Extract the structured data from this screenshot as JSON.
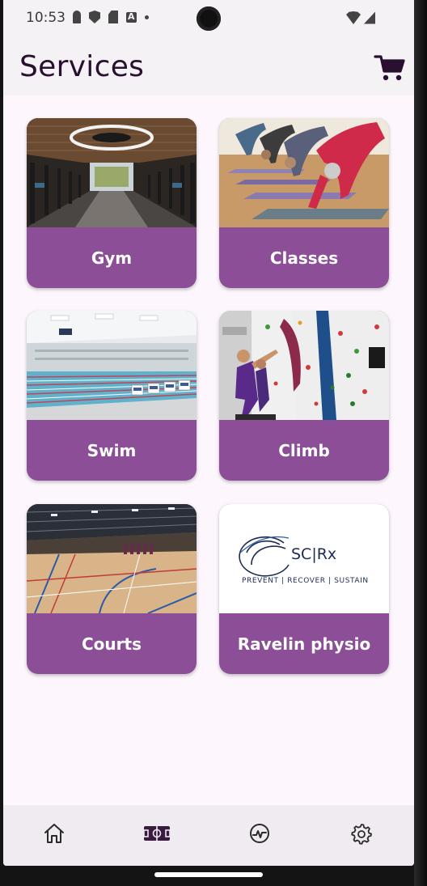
{
  "status_bar": {
    "time": "10:53",
    "icons": [
      "person-icon",
      "shield-icon",
      "sd-card-icon",
      "a-icon",
      "dot-icon"
    ],
    "right_icons": [
      "wifi-icon",
      "signal-icon"
    ]
  },
  "app_bar": {
    "title": "Services",
    "cart_icon": "cart-icon"
  },
  "services": [
    {
      "label": "Gym",
      "image": "gym-photo"
    },
    {
      "label": "Classes",
      "image": "yoga-class-photo"
    },
    {
      "label": "Swim",
      "image": "swimming-pool-photo"
    },
    {
      "label": "Climb",
      "image": "climbing-wall-photo"
    },
    {
      "label": "Courts",
      "image": "sports-hall-photo"
    },
    {
      "label": "Ravelin physio",
      "image": "scrx-logo"
    }
  ],
  "scrx_logo": {
    "brand": "SC|Rx",
    "tagline": "PREVENT | RECOVER | SUSTAIN"
  },
  "bottom_nav": [
    {
      "icon": "home-icon",
      "active": false
    },
    {
      "icon": "stadium-icon",
      "active": true
    },
    {
      "icon": "activity-icon",
      "active": false
    },
    {
      "icon": "settings-icon",
      "active": false
    }
  ],
  "colors": {
    "card": "#8b4e97",
    "background": "#fdf7fd",
    "title": "#2a1030",
    "nav_bg": "#f0ebf0"
  }
}
